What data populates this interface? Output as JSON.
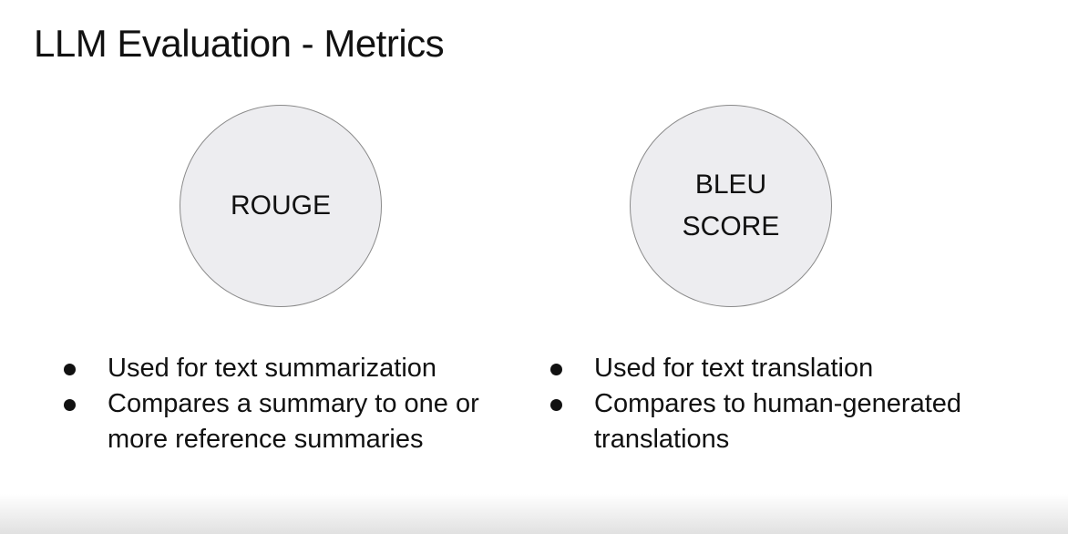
{
  "title": "LLM Evaluation - Metrics",
  "metrics": [
    {
      "circle_lines": [
        "ROUGE"
      ],
      "bullets": [
        "Used for text summarization",
        "Compares a summary to one or more reference summaries"
      ]
    },
    {
      "circle_lines": [
        "BLEU",
        "SCORE"
      ],
      "bullets": [
        "Used for text translation",
        "Compares to human-generated translations"
      ]
    }
  ],
  "colors": {
    "circle_fill": "#ededf0",
    "circle_border": "#8a8a8a",
    "text": "#111111",
    "background": "#ffffff"
  }
}
